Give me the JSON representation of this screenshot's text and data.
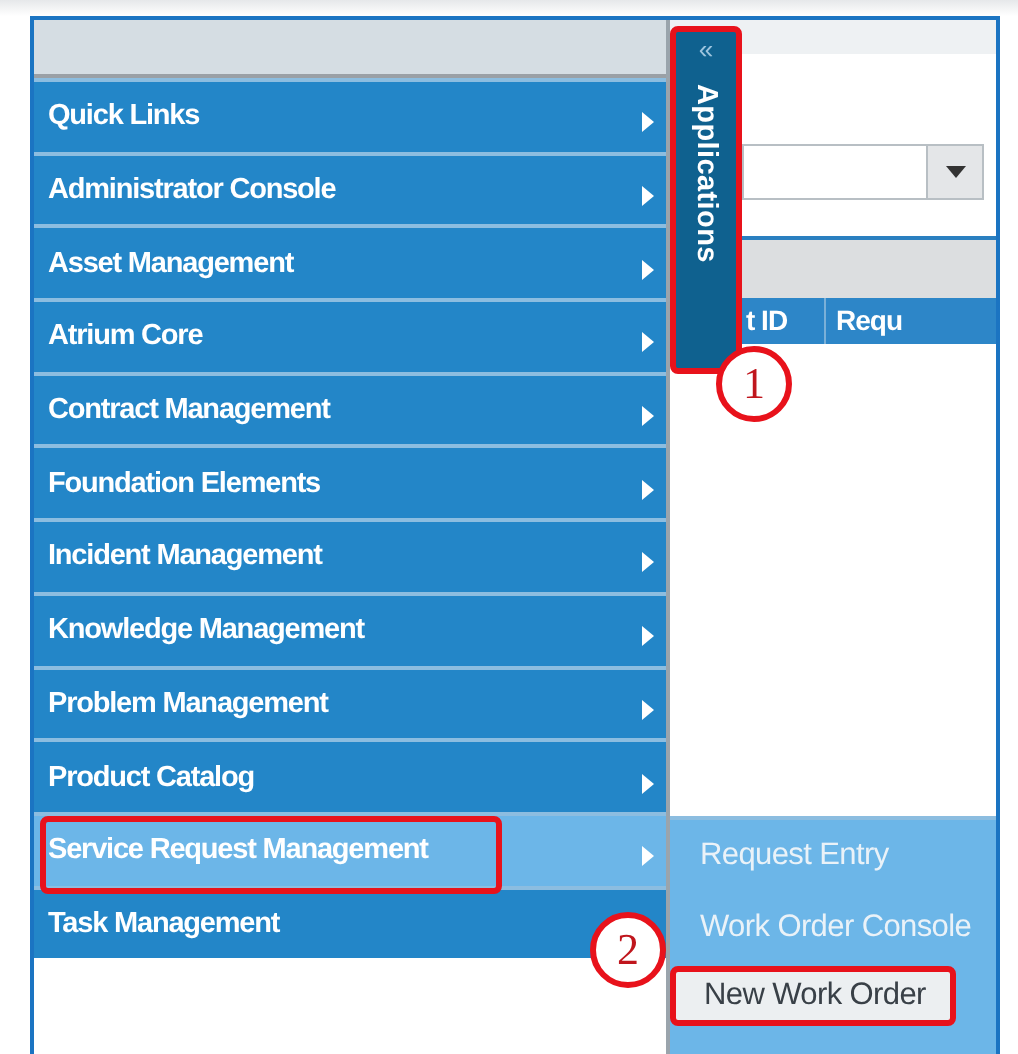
{
  "apps_tab": {
    "collapse": "«",
    "label": "Applications"
  },
  "menu": [
    {
      "label": "Quick Links",
      "selected": false,
      "arrow": true
    },
    {
      "label": "Administrator Console",
      "selected": false,
      "arrow": true
    },
    {
      "label": "Asset Management",
      "selected": false,
      "arrow": true
    },
    {
      "label": "Atrium Core",
      "selected": false,
      "arrow": true
    },
    {
      "label": "Contract Management",
      "selected": false,
      "arrow": true
    },
    {
      "label": "Foundation Elements",
      "selected": false,
      "arrow": true
    },
    {
      "label": "Incident Management",
      "selected": false,
      "arrow": true
    },
    {
      "label": "Knowledge Management",
      "selected": false,
      "arrow": true
    },
    {
      "label": "Problem Management",
      "selected": false,
      "arrow": true
    },
    {
      "label": "Product Catalog",
      "selected": false,
      "arrow": true
    },
    {
      "label": "Service Request Management",
      "selected": true,
      "arrow": true
    },
    {
      "label": "Task Management",
      "selected": false,
      "arrow": false
    }
  ],
  "submenu": [
    {
      "label": "Request Entry",
      "selected": false
    },
    {
      "label": "Work Order Console",
      "selected": false
    },
    {
      "label": "New Work Order",
      "selected": true
    }
  ],
  "table": {
    "columns": [
      "t ID",
      "Requ"
    ]
  },
  "callouts": [
    {
      "label": "1"
    },
    {
      "label": "2"
    }
  ]
}
